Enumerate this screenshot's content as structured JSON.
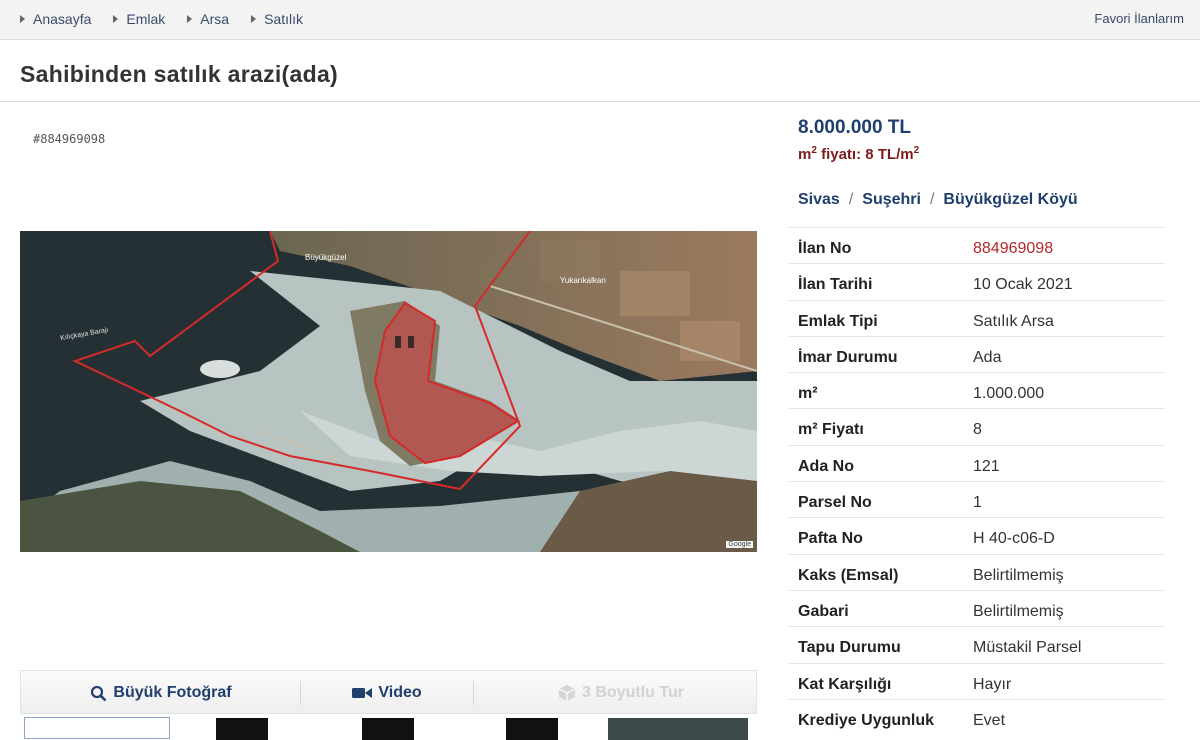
{
  "breadcrumb": [
    {
      "label": "Anasayfa"
    },
    {
      "label": "Emlak"
    },
    {
      "label": "Arsa"
    },
    {
      "label": "Satılık"
    }
  ],
  "favorites_link": "Favori İlanlarım",
  "title": "Sahibinden satılık arazi(ada)",
  "listing_code": "#884969098",
  "map": {
    "labels": [
      "Büyükgüzel",
      "Yukarıkalkan",
      "Kılıçkaya Barajı"
    ],
    "attribution": "Google"
  },
  "media_tabs": [
    {
      "label": "Büyük Fotoğraf",
      "icon": "magnifier-icon",
      "enabled": true
    },
    {
      "label": "Video",
      "icon": "video-camera-icon",
      "enabled": true
    },
    {
      "label": "3 Boyutlu Tur",
      "icon": "cube-icon",
      "enabled": false
    }
  ],
  "price": "8.000.000 TL",
  "m2_price": {
    "prefix": "m",
    "sup": "2",
    "middle": " fiyatı: 8 TL/m",
    "sup2": "2"
  },
  "location": [
    "Sivas",
    "Suşehri",
    "Büyükgüzel Köyü"
  ],
  "details": [
    {
      "label": "İlan No",
      "value": "884969098",
      "highlight": true
    },
    {
      "label": "İlan Tarihi",
      "value": "10 Ocak 2021"
    },
    {
      "label": "Emlak Tipi",
      "value": "Satılık Arsa"
    },
    {
      "label": "İmar Durumu",
      "value": "Ada"
    },
    {
      "label": "m²",
      "value": "1.000.000"
    },
    {
      "label": "m² Fiyatı",
      "value": "8"
    },
    {
      "label": "Ada No",
      "value": "121"
    },
    {
      "label": "Parsel No",
      "value": "1"
    },
    {
      "label": "Pafta No",
      "value": "H 40-c06-D"
    },
    {
      "label": "Kaks (Emsal)",
      "value": "Belirtilmemiş"
    },
    {
      "label": "Gabari",
      "value": "Belirtilmemiş"
    },
    {
      "label": "Tapu Durumu",
      "value": "Müstakil Parsel"
    },
    {
      "label": "Kat Karşılığı",
      "value": "Hayır"
    },
    {
      "label": "Krediye Uygunluk",
      "value": "Evet"
    }
  ],
  "colors": {
    "link": "#1f3f6e",
    "price_red": "#7d1c1c",
    "id_red": "#b3262a",
    "parcel_outline": "#d42a2a"
  }
}
